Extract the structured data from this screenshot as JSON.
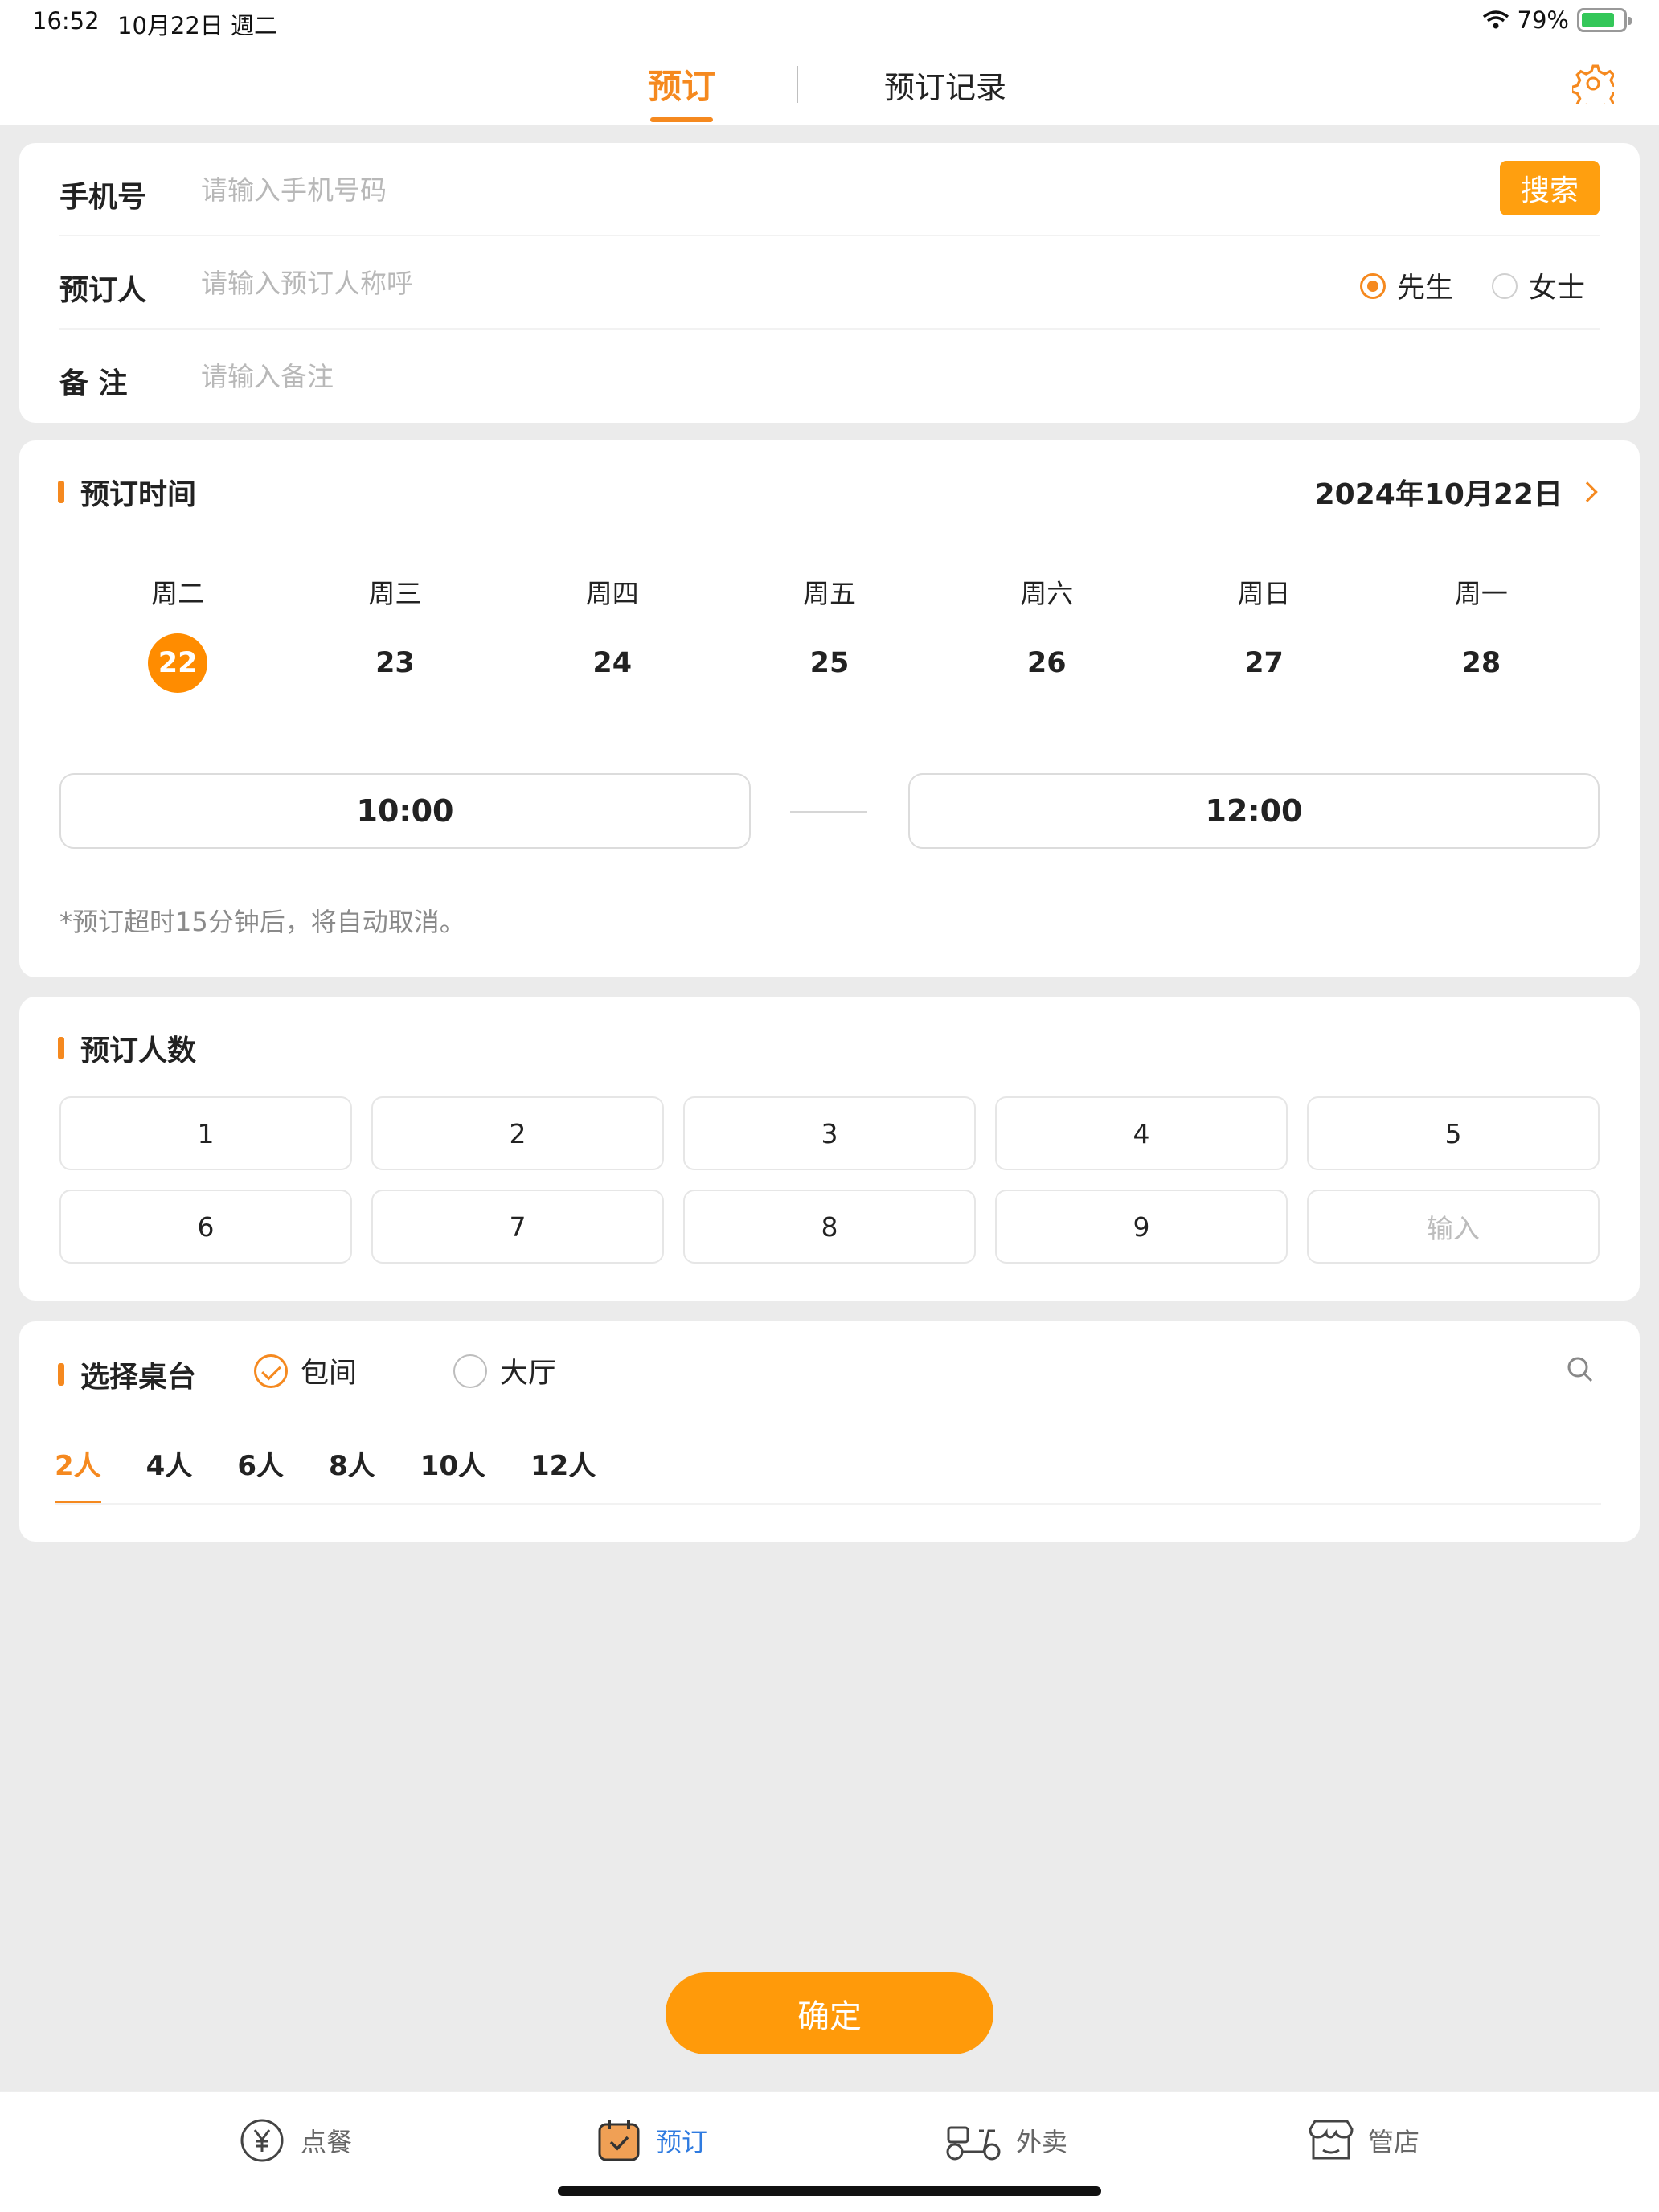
{
  "status_bar": {
    "time": "16:52",
    "date": "10月22日 週二",
    "battery": "79%",
    "battery_level": 0.79
  },
  "header": {
    "tab_active": "预订",
    "tab_records": "预订记录",
    "settings_icon": "gear-icon"
  },
  "form": {
    "phone_label": "手机号",
    "phone_placeholder": "请输入手机号码",
    "search_label": "搜索",
    "name_label": "预订人",
    "name_placeholder": "请输入预订人称呼",
    "gender_male": "先生",
    "gender_female": "女士",
    "gender_selected": "先生",
    "note_label": "备 注",
    "note_placeholder": "请输入备注"
  },
  "booking_time": {
    "title": "预订时间",
    "date_display": "2024年10月22日",
    "days": [
      {
        "weekday": "周二",
        "day": "22"
      },
      {
        "weekday": "周三",
        "day": "23"
      },
      {
        "weekday": "周四",
        "day": "24"
      },
      {
        "weekday": "周五",
        "day": "25"
      },
      {
        "weekday": "周六",
        "day": "26"
      },
      {
        "weekday": "周日",
        "day": "27"
      },
      {
        "weekday": "周一",
        "day": "28"
      }
    ],
    "selected_day": "22",
    "start_time": "10:00",
    "end_time": "12:00",
    "note": "*预订超时15分钟后，将自动取消。"
  },
  "party_size": {
    "title": "预订人数",
    "options": [
      "1",
      "2",
      "3",
      "4",
      "5",
      "6",
      "7",
      "8",
      "9"
    ],
    "input_placeholder": "输入"
  },
  "table_select": {
    "title": "选择桌台",
    "type_private": "包间",
    "type_hall": "大厅",
    "selected_type": "包间",
    "capacity_tabs": [
      "2人",
      "4人",
      "6人",
      "8人",
      "10人",
      "12人"
    ],
    "selected_capacity": "2人"
  },
  "confirm_label": "确定",
  "bottom_nav": {
    "order": "点餐",
    "reserve": "预订",
    "takeout": "外卖",
    "store": "管店",
    "active": "预订"
  },
  "colors": {
    "accent": "#f5891f",
    "button": "#ff9f0f",
    "active_nav": "#2f7be0"
  }
}
